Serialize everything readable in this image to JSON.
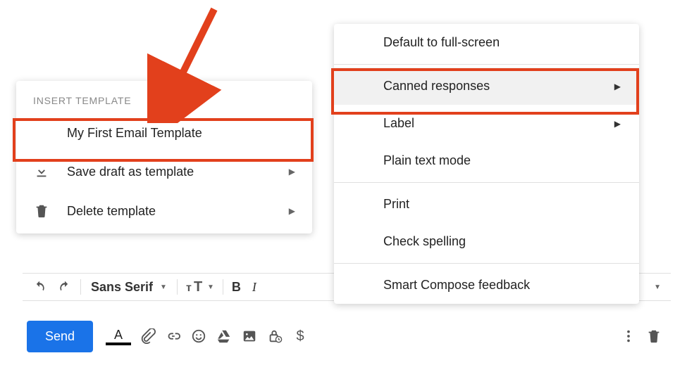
{
  "submenu": {
    "header": "INSERT TEMPLATE",
    "template_item": "My First Email Template",
    "save_draft": "Save draft as template",
    "delete_template": "Delete template"
  },
  "main_menu": {
    "default_full": "Default to full-screen",
    "canned": "Canned responses",
    "label": "Label",
    "plain_text": "Plain text mode",
    "print": "Print",
    "check_spelling": "Check spelling",
    "smart_compose": "Smart Compose feedback"
  },
  "toolbar": {
    "font": "Sans Serif",
    "bold": "B"
  },
  "bottombar": {
    "send": "Send",
    "textcolor_letter": "A",
    "dollar": "$"
  }
}
